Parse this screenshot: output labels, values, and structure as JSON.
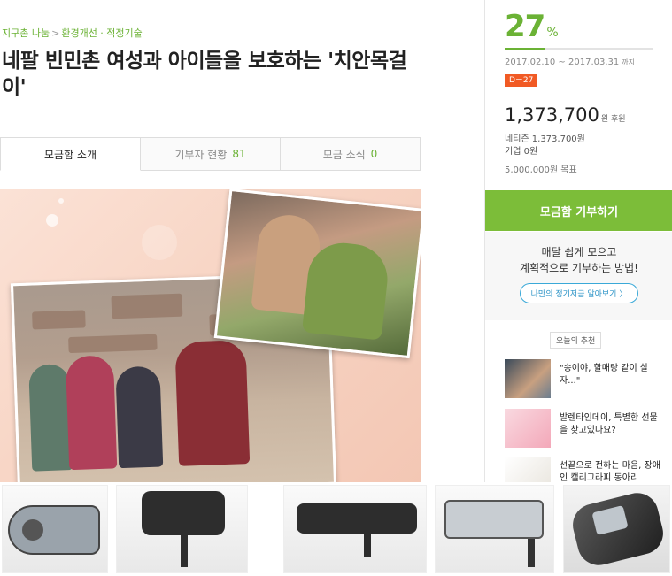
{
  "breadcrumb": {
    "root": "지구촌 나눔",
    "sep": ">",
    "category": "환경개선 · 적정기술"
  },
  "title": "네팔 빈민촌 여성과 아이들을 보호하는 '치안목걸이'",
  "tabs": [
    {
      "label": "모금함 소개",
      "count": ""
    },
    {
      "label": "기부자 현황",
      "count": "81"
    },
    {
      "label": "모금 소식",
      "count": "0"
    }
  ],
  "stats": {
    "percent": "27",
    "percent_unit": "%",
    "progress_fraction": 0.27,
    "period": "2017.02.10 ~ 2017.03.31",
    "period_suffix": "까지",
    "dday": "D－27",
    "amount": "1,373,700",
    "amount_unit": "원 후원",
    "netizen": "네티즌 1,373,700원",
    "company": "기업 0원",
    "goal": "5,000,000원 목표"
  },
  "donate_button": "모금함 기부하기",
  "regular": {
    "line1": "매달 쉽게 모으고",
    "line2": "계획적으로 기부하는 방법!",
    "link": "나만의 정기저금 알아보기 〉"
  },
  "recommend": {
    "header": "오늘의 추천",
    "items": [
      {
        "text": "\"송이야, 할매랑 같이 살자...\""
      },
      {
        "text": "발렌타인데이, 특별한 선물을 찾고있나요?"
      },
      {
        "text": "선끝으로 전하는 마음, 장애인 캘리그라피 동아리"
      }
    ]
  },
  "colors": {
    "accent": "#6bb235",
    "button": "#7cbd39",
    "dday": "#f15a24",
    "link": "#2b93c6"
  }
}
